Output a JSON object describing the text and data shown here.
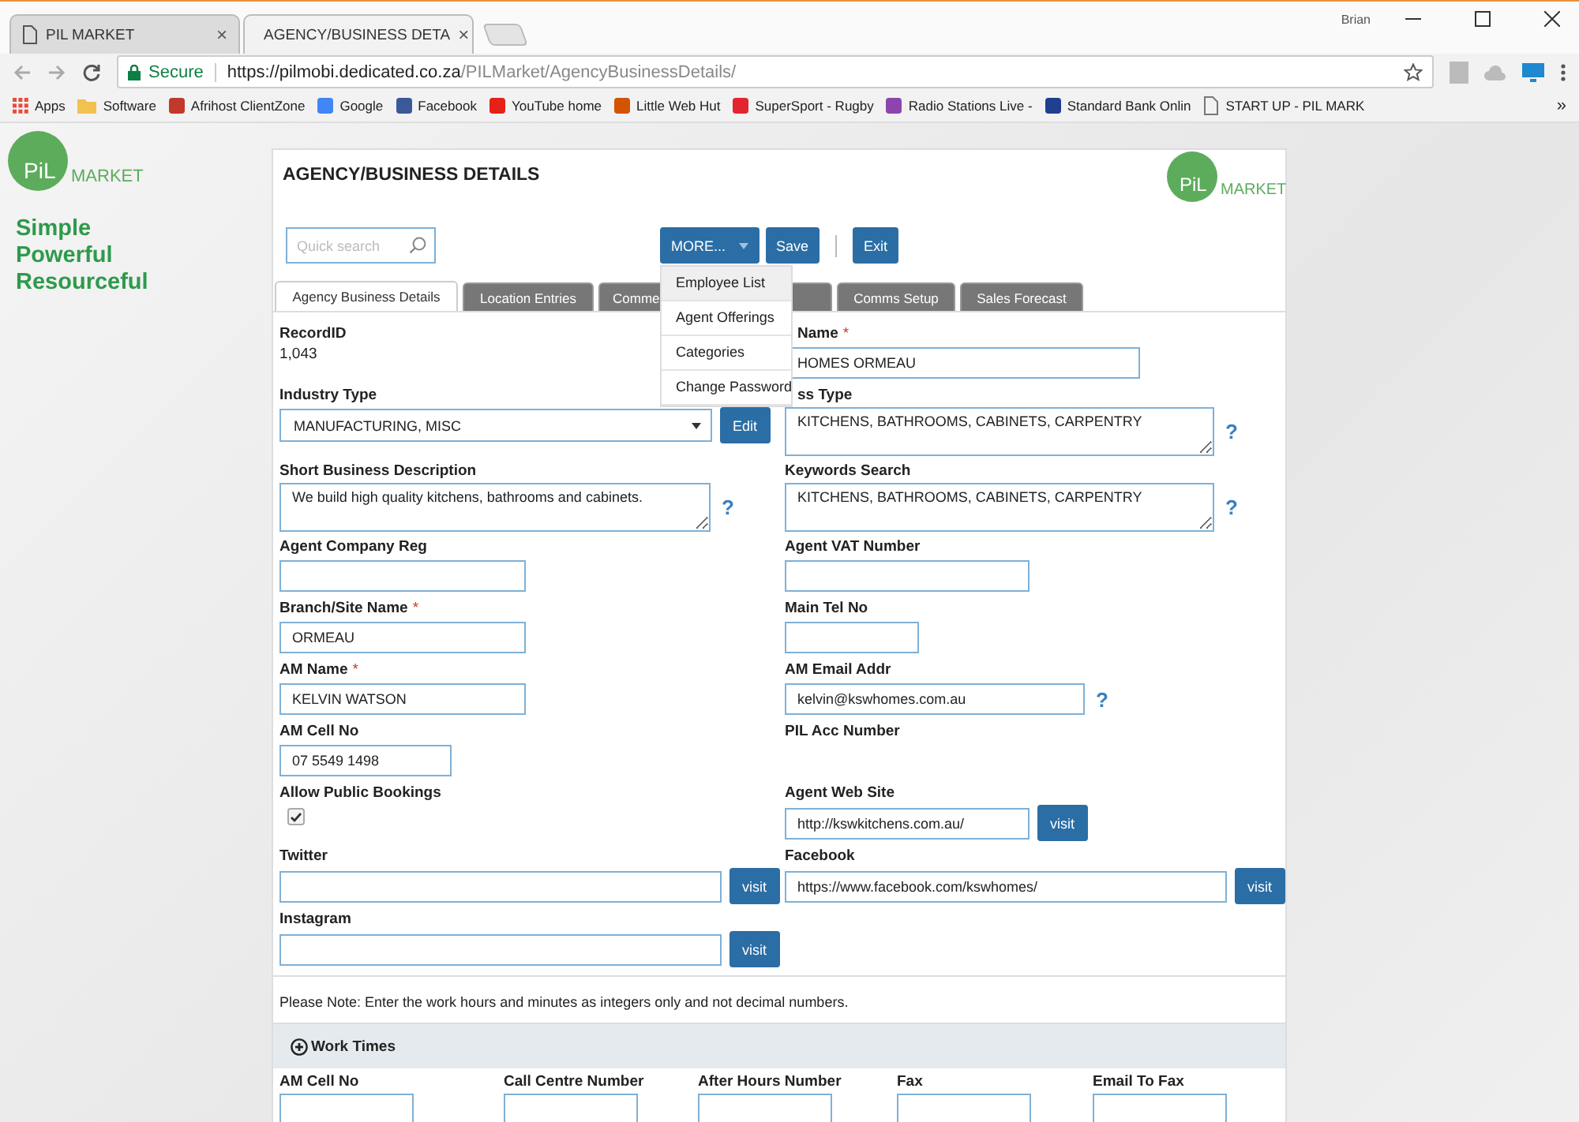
{
  "browser": {
    "tabs": [
      {
        "title": "PIL MARKET",
        "close": "×",
        "selected": false
      },
      {
        "title": "AGENCY/BUSINESS DETA",
        "close": "×",
        "selected": true
      }
    ],
    "user": "Brian",
    "address": {
      "secure": "Secure",
      "host": "https://pilmobi.dedicated.co.za",
      "path": "/PILMarket/AgencyBusinessDetails/"
    },
    "bookmarks": [
      {
        "label": "Apps",
        "kind": "apps",
        "color": "#e84c3d"
      },
      {
        "label": "Software",
        "kind": "folder",
        "color": "#f2c14e"
      },
      {
        "label": "Afrihost ClientZone",
        "kind": "site",
        "color": "#c0392b"
      },
      {
        "label": "Google",
        "kind": "site",
        "color": "#4285f4"
      },
      {
        "label": "Facebook",
        "kind": "site",
        "color": "#3b5998"
      },
      {
        "label": "YouTube home",
        "kind": "site",
        "color": "#e62117"
      },
      {
        "label": "Little Web Hut",
        "kind": "site",
        "color": "#d35400"
      },
      {
        "label": "SuperSport - Rugby",
        "kind": "site",
        "color": "#e3262e"
      },
      {
        "label": "Radio Stations Live -",
        "kind": "site",
        "color": "#8e44ad"
      },
      {
        "label": "Standard Bank Onlin",
        "kind": "site",
        "color": "#1f3f8f"
      },
      {
        "label": "START UP - PIL MARK",
        "kind": "page",
        "color": "#777777"
      }
    ],
    "more": "»"
  },
  "sidebar": {
    "logo": {
      "pil": "PiL",
      "market": "MARKET"
    },
    "tagline": [
      "Simple",
      "Powerful",
      "Resourceful"
    ]
  },
  "panel": {
    "title": "AGENCY/BUSINESS DETAILS",
    "logo": {
      "pil": "PiL",
      "market": "MARKET"
    },
    "search": {
      "placeholder": "Quick search"
    },
    "buttons": {
      "more": "MORE...",
      "save": "Save",
      "exit": "Exit"
    },
    "menu": [
      {
        "label": "Employee List",
        "selected": true
      },
      {
        "label": "Agent Offerings",
        "selected": false
      },
      {
        "label": "Categories",
        "selected": false
      },
      {
        "label": "Change Password",
        "selected": false
      }
    ],
    "tabs": [
      {
        "label": "Agency Business Details",
        "selected": true
      },
      {
        "label": "Location Entries",
        "selected": false
      },
      {
        "label": "Comme",
        "selected": false
      },
      {
        "label": "Comms Setup",
        "selected": false
      },
      {
        "label": "Sales Forecast",
        "selected": false
      }
    ],
    "rows": [
      {
        "left": {
          "kind": "readonly",
          "label": "RecordID",
          "value": "1,043"
        },
        "right": {
          "kind": "text",
          "label": "Name",
          "mark": "*",
          "value": "HOMES ORMEAU"
        }
      },
      {
        "left": {
          "kind": "select",
          "label": "Industry Type",
          "value": "MANUFACTURING, MISC",
          "action": "Edit"
        },
        "right": {
          "kind": "textarea",
          "label": "ss Type",
          "value": "KITCHENS, BATHROOMS, CABINETS, CARPENTRY",
          "help": "?"
        }
      },
      {
        "left": {
          "kind": "textarea",
          "label": "Short Business Description",
          "value": "We build high quality kitchens, bathrooms and cabinets.",
          "help": "?"
        },
        "right": {
          "kind": "textarea",
          "label": "Keywords Search",
          "value": "KITCHENS, BATHROOMS, CABINETS, CARPENTRY",
          "help": "?"
        }
      },
      {
        "left": {
          "kind": "text",
          "label": "Agent Company Reg"
        },
        "right": {
          "kind": "text",
          "label": "Agent VAT Number"
        }
      },
      {
        "left": {
          "kind": "text",
          "label": "Branch/Site Name",
          "mark": "*",
          "value": "ORMEAU"
        },
        "right": {
          "kind": "text",
          "label": "Main Tel No"
        }
      },
      {
        "left": {
          "kind": "text",
          "label": "AM Name",
          "mark": "*",
          "value": "KELVIN WATSON"
        },
        "right": {
          "kind": "text",
          "label": "AM Email Addr",
          "value": "kelvin@kswhomes.com.au",
          "help": "?"
        }
      },
      {
        "left": {
          "kind": "text",
          "label": "AM Cell No",
          "value": "07 5549 1498"
        },
        "right": {
          "kind": "label",
          "label": "PIL Acc Number"
        }
      },
      {
        "left": {
          "kind": "checkbox",
          "label": "Allow Public Bookings",
          "checked": true
        },
        "right": {
          "kind": "text",
          "label": "Agent Web Site",
          "value": "http://kswkitchens.com.au/",
          "action": "visit"
        }
      },
      {
        "left": {
          "kind": "text",
          "label": "Twitter",
          "action": "visit"
        },
        "right": {
          "kind": "text",
          "label": "Facebook",
          "value": "https://www.facebook.com/kswhomes/",
          "action": "visit"
        }
      },
      {
        "left": {
          "kind": "text",
          "label": "Instagram",
          "action": "visit"
        }
      }
    ],
    "note": "Please Note: Enter the work hours and minutes as integers only and not decimal numbers.",
    "section": {
      "title": "Work Times",
      "expanded": false
    },
    "bottom_fields": [
      {
        "label": "AM Cell No"
      },
      {
        "label": "Call Centre Number"
      },
      {
        "label": "After Hours Number"
      },
      {
        "label": "Fax"
      },
      {
        "label": "Email To Fax"
      }
    ]
  }
}
